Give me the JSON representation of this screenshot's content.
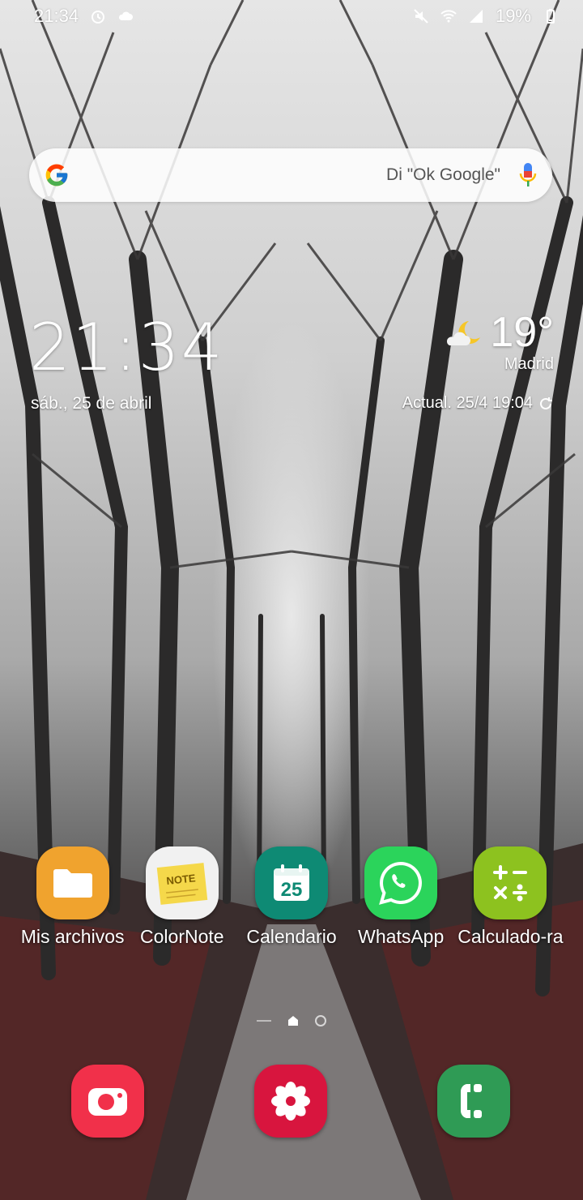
{
  "status_bar": {
    "time": "21:34",
    "battery": "19%"
  },
  "search": {
    "hint": "Di \"Ok Google\"",
    "logo_icon": "google-g-icon",
    "mic_icon": "mic-icon"
  },
  "clock_widget": {
    "time": "21:34",
    "date": "sáb., 25 de abril"
  },
  "weather_widget": {
    "icon": "moon-cloud-icon",
    "temperature": "19°",
    "city": "Madrid",
    "updated": "Actual. 25/4 19:04"
  },
  "apps": [
    {
      "label": "Mis archivos",
      "icon": "folder-icon",
      "color": "#F0A32E"
    },
    {
      "label": "ColorNote",
      "icon": "note-icon",
      "color": "#F1F1F1"
    },
    {
      "label": "Calendario",
      "icon": "calendar-icon",
      "color": "#0E8A74",
      "day": "25"
    },
    {
      "label": "WhatsApp",
      "icon": "whatsapp-icon",
      "color": "#2BD45B"
    },
    {
      "label": "Calculado-ra",
      "icon": "calculator-icon",
      "color": "#8DC21F"
    }
  ],
  "dock": [
    {
      "name": "camera",
      "icon": "camera-icon",
      "color": "#F1304A"
    },
    {
      "name": "gallery",
      "icon": "flower-icon",
      "color": "#D8153E"
    },
    {
      "name": "phone",
      "icon": "phone-icon",
      "color": "#2F9B55"
    }
  ]
}
